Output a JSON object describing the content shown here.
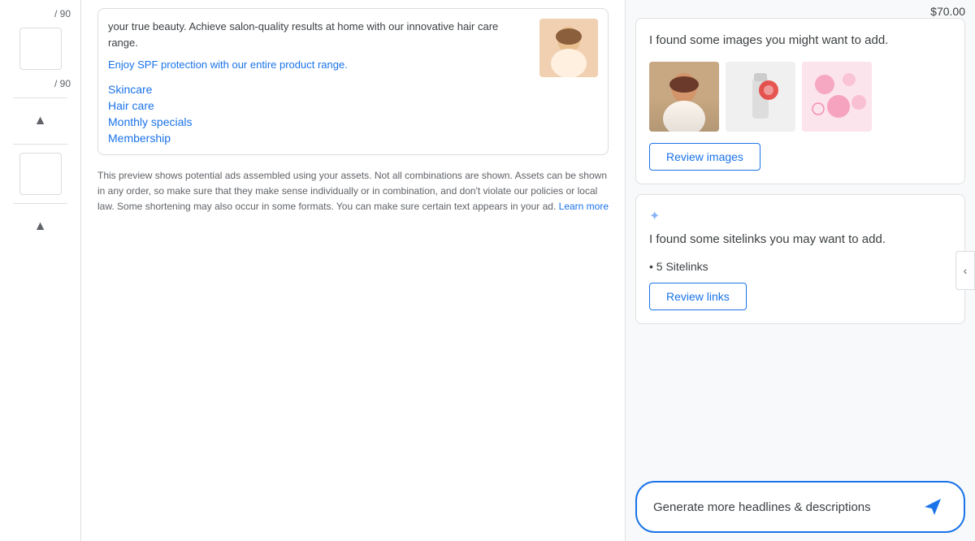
{
  "sidebar": {
    "counter1_label": "/ 90",
    "counter2_label": "/ 90",
    "chevron_up": "▲"
  },
  "ad_preview": {
    "body_text": "your true beauty. Achieve salon-quality results at home with our innovative hair care range.",
    "spf_link": "Enjoy SPF protection with our entire product range.",
    "links": [
      {
        "label": "Skincare"
      },
      {
        "label": "Hair care"
      },
      {
        "label": "Monthly specials"
      },
      {
        "label": "Membership"
      }
    ],
    "info_text": "This preview shows potential ads assembled using your assets. Not all combinations are shown. Assets can be shown in any order, so make sure that they make sense individually or in combination, and don't violate our policies or local law. Some shortening may also occur in some formats. You can make sure certain text appears in your ad.",
    "learn_more": "Learn more"
  },
  "right_panel": {
    "price": "$70.00",
    "images_card": {
      "title": "I found some images you might want to add.",
      "review_btn": "Review images"
    },
    "sitelinks_card": {
      "sparkle": "✦",
      "title": "I found some sitelinks you may want to add.",
      "sitelinks_count": "5 Sitelinks",
      "review_btn": "Review links"
    },
    "generate_btn": {
      "text": "Generate more headlines & descriptions",
      "send_icon": "▷"
    }
  }
}
